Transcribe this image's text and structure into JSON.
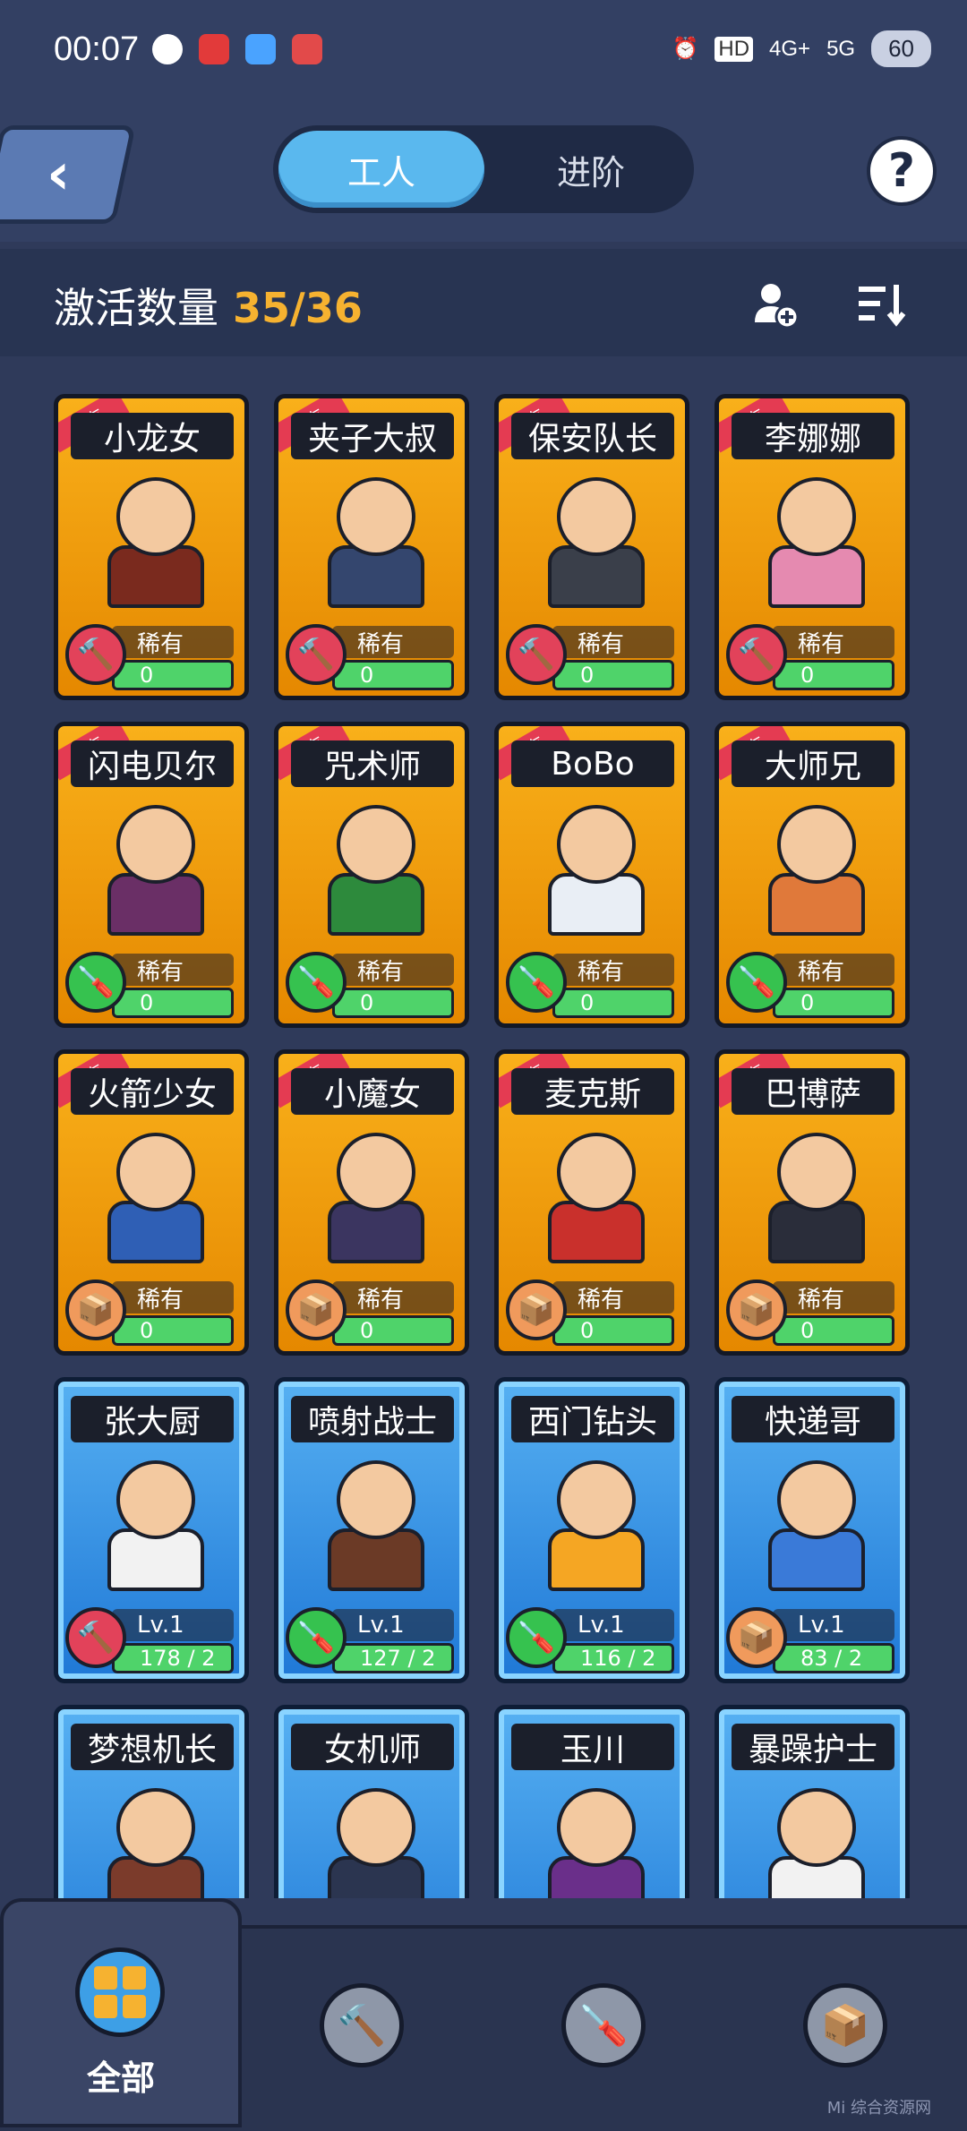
{
  "status_bar": {
    "time": "00:07",
    "network_a": "4G+",
    "network_b": "5G",
    "battery": "60"
  },
  "header": {
    "tabs": [
      {
        "label": "工人",
        "active": true
      },
      {
        "label": "进阶",
        "active": false
      }
    ],
    "help_symbol": "?"
  },
  "summary": {
    "label": "激活数量",
    "value": "35/36"
  },
  "colors": {
    "accent": "#f6b230",
    "rare_card": "#f9b01a",
    "common_card": "#3d9fe6",
    "progress": "#4fd36a"
  },
  "workers": [
    {
      "name": "小龙女",
      "ribbon": "稀有",
      "tier": "稀有",
      "progress": "0",
      "tool": "hammer-icon",
      "style": "gold",
      "color": "#7a2a1e"
    },
    {
      "name": "夹子大叔",
      "ribbon": "稀有",
      "tier": "稀有",
      "progress": "0",
      "tool": "hammer-icon",
      "style": "gold",
      "color": "#34466e"
    },
    {
      "name": "保安队长",
      "ribbon": "稀有",
      "tier": "稀有",
      "progress": "0",
      "tool": "hammer-icon",
      "style": "gold",
      "color": "#3a3f4a"
    },
    {
      "name": "李娜娜",
      "ribbon": "稀有",
      "tier": "稀有",
      "progress": "0",
      "tool": "hammer-icon",
      "style": "gold",
      "color": "#e58ab0"
    },
    {
      "name": "闪电贝尔",
      "ribbon": "稀有",
      "tier": "稀有",
      "progress": "0",
      "tool": "screwdriver-icon",
      "style": "gold",
      "color": "#6a2f66"
    },
    {
      "name": "咒术师",
      "ribbon": "稀有",
      "tier": "稀有",
      "progress": "0",
      "tool": "screwdriver-icon",
      "style": "gold",
      "color": "#2d8a3c"
    },
    {
      "name": "BoBo",
      "ribbon": "稀有",
      "tier": "稀有",
      "progress": "0",
      "tool": "screwdriver-icon",
      "style": "gold",
      "color": "#e9eef5"
    },
    {
      "name": "大师兄",
      "ribbon": "稀有",
      "tier": "稀有",
      "progress": "0",
      "tool": "screwdriver-icon",
      "style": "gold",
      "color": "#e0793a"
    },
    {
      "name": "火箭少女",
      "ribbon": "稀有",
      "tier": "稀有",
      "progress": "0",
      "tool": "box-icon",
      "style": "gold",
      "color": "#2f5fb5"
    },
    {
      "name": "小魔女",
      "ribbon": "稀有",
      "tier": "稀有",
      "progress": "0",
      "tool": "box-icon",
      "style": "gold",
      "color": "#3b3560"
    },
    {
      "name": "麦克斯",
      "ribbon": "稀有",
      "tier": "稀有",
      "progress": "0",
      "tool": "box-icon",
      "style": "gold",
      "color": "#c9302c"
    },
    {
      "name": "巴博萨",
      "ribbon": "稀有",
      "tier": "稀有",
      "progress": "0",
      "tool": "box-icon",
      "style": "gold",
      "color": "#2a2d3a"
    },
    {
      "name": "张大厨",
      "ribbon": "",
      "tier": "Lv.1",
      "progress": "178 / 2",
      "tool": "hammer-icon",
      "style": "blue",
      "color": "#f2f2f2"
    },
    {
      "name": "喷射战士",
      "ribbon": "",
      "tier": "Lv.1",
      "progress": "127 / 2",
      "tool": "screwdriver-icon",
      "style": "blue",
      "color": "#6b3a26"
    },
    {
      "name": "西门钻头",
      "ribbon": "",
      "tier": "Lv.1",
      "progress": "116 / 2",
      "tool": "screwdriver-icon",
      "style": "blue",
      "color": "#f5a623"
    },
    {
      "name": "快递哥",
      "ribbon": "",
      "tier": "Lv.1",
      "progress": "83 / 2",
      "tool": "box-icon",
      "style": "blue",
      "color": "#3a7ad8"
    },
    {
      "name": "梦想机长",
      "ribbon": "",
      "tier": "",
      "progress": "",
      "tool": "",
      "style": "blue",
      "color": "#7b3b2b"
    },
    {
      "name": "女机师",
      "ribbon": "",
      "tier": "",
      "progress": "",
      "tool": "",
      "style": "blue",
      "color": "#2b3550"
    },
    {
      "name": "玉川",
      "ribbon": "",
      "tier": "",
      "progress": "",
      "tool": "",
      "style": "blue",
      "color": "#6a2f8a"
    },
    {
      "name": "暴躁护士",
      "ribbon": "",
      "tier": "",
      "progress": "",
      "tool": "",
      "style": "blue",
      "color": "#f2f2f2"
    }
  ],
  "bottom_nav": [
    {
      "label": "全部",
      "icon": "grid-icon",
      "active": true
    },
    {
      "label": "",
      "icon": "hammer-icon",
      "active": false
    },
    {
      "label": "",
      "icon": "screwdriver-icon",
      "active": false
    },
    {
      "label": "",
      "icon": "box-icon",
      "active": false
    }
  ],
  "watermark": "Mi 综合资源网"
}
